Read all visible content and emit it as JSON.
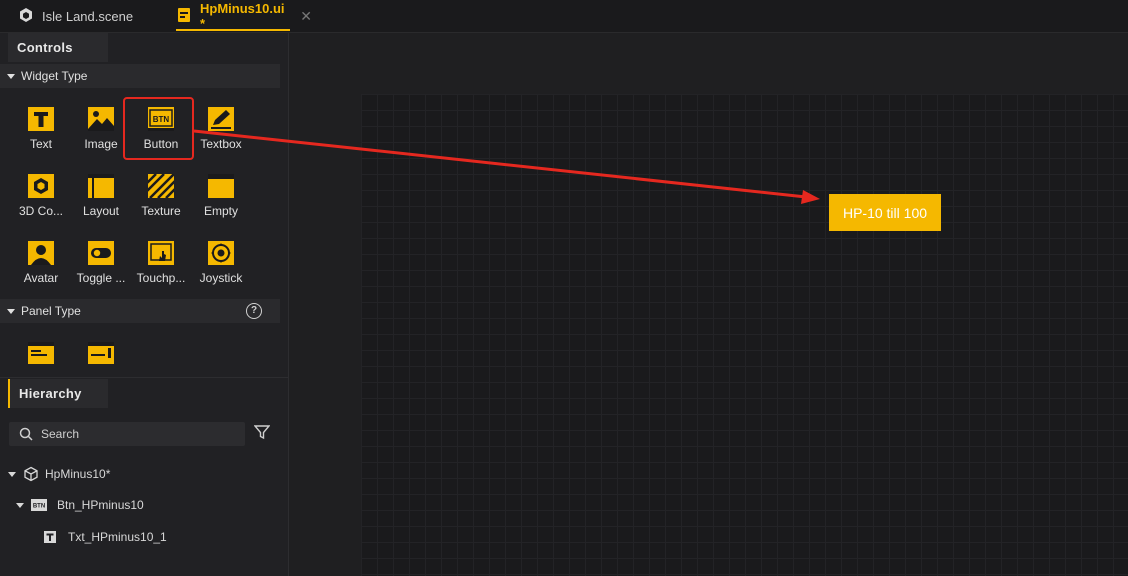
{
  "tabs": [
    {
      "label": "Isle Land.scene",
      "icon": "scene-cube-icon"
    },
    {
      "label": "HpMinus10.ui *",
      "icon": "ui-file-icon",
      "close": "✕"
    }
  ],
  "controls": {
    "header": "Controls",
    "widget_section": "Widget Type",
    "widgets": [
      {
        "label": "Text",
        "icon": "text-widget-icon"
      },
      {
        "label": "Image",
        "icon": "image-widget-icon"
      },
      {
        "label": "Button",
        "icon": "button-widget-icon"
      },
      {
        "label": "Textbox",
        "icon": "textbox-widget-icon"
      },
      {
        "label": "3D Co...",
        "icon": "3d-container-icon"
      },
      {
        "label": "Layout",
        "icon": "layout-widget-icon"
      },
      {
        "label": "Texture",
        "icon": "texture-widget-icon"
      },
      {
        "label": "Empty",
        "icon": "empty-widget-icon"
      },
      {
        "label": "Avatar",
        "icon": "avatar-widget-icon"
      },
      {
        "label": "Toggle ...",
        "icon": "toggle-widget-icon"
      },
      {
        "label": "Touchp...",
        "icon": "touchpad-widget-icon"
      },
      {
        "label": "Joystick",
        "icon": "joystick-widget-icon"
      }
    ],
    "panel_section": "Panel Type",
    "button_icon_text": "BTN",
    "help_glyph": "?"
  },
  "hierarchy": {
    "header": "Hierarchy",
    "search_placeholder": "Search",
    "items": [
      {
        "label": "HpMinus10*",
        "icon": "cube-outline-icon"
      },
      {
        "label": "Btn_HPminus10",
        "icon": "button-node-icon"
      },
      {
        "label": "Txt_HPminus10_1",
        "icon": "text-node-icon"
      }
    ]
  },
  "canvas": {
    "button_text": "HP-10 till 100"
  },
  "colors": {
    "accent": "#f5b800",
    "highlight": "#e5281f",
    "panel": "#212124"
  }
}
